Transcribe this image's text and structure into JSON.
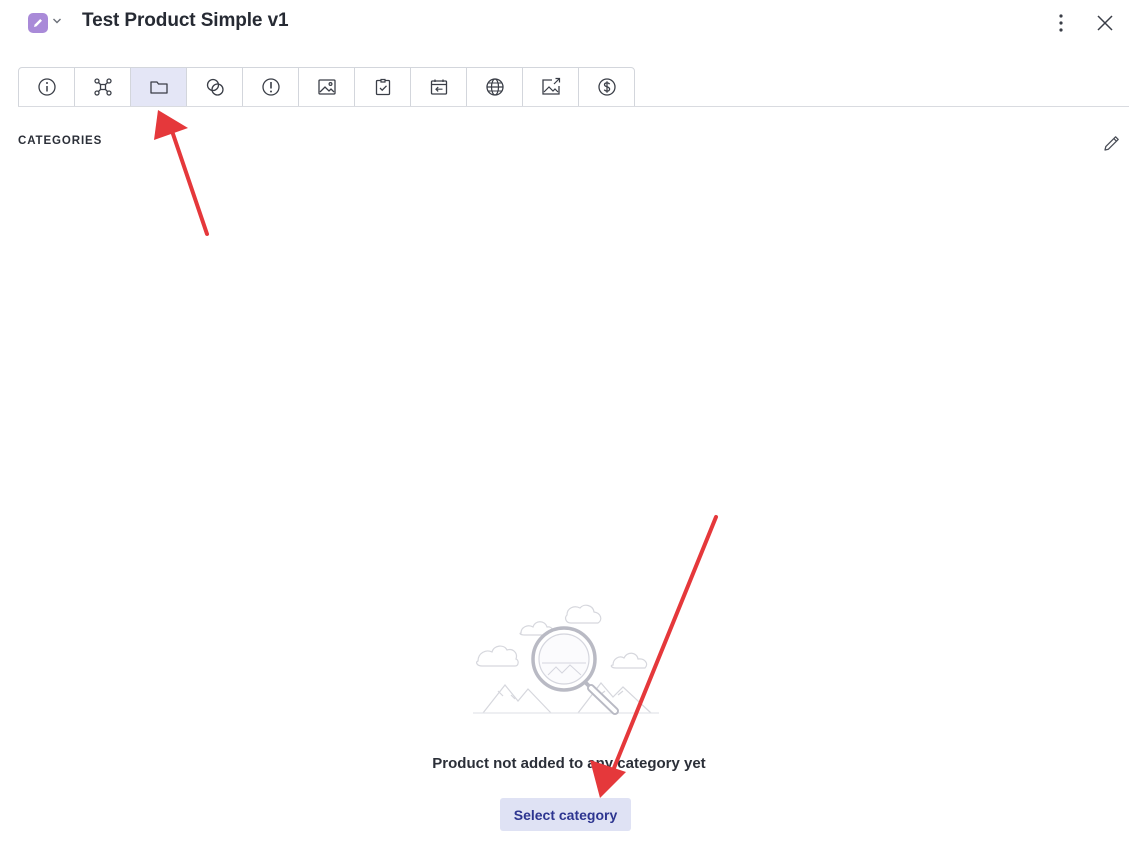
{
  "header": {
    "title": "Test Product Simple v1",
    "app_icon": "pencil-icon",
    "app_icon_color": "#a98ad8"
  },
  "toolbar": {
    "active_index": 2,
    "active_color": "#e4e6f6",
    "tabs": [
      {
        "icon": "info-icon"
      },
      {
        "icon": "network-icon"
      },
      {
        "icon": "folder-icon"
      },
      {
        "icon": "overlap-circles-icon"
      },
      {
        "icon": "alert-icon"
      },
      {
        "icon": "image-icon"
      },
      {
        "icon": "clipboard-check-icon"
      },
      {
        "icon": "calendar-back-icon"
      },
      {
        "icon": "globe-icon"
      },
      {
        "icon": "image-export-icon"
      },
      {
        "icon": "dollar-icon"
      }
    ]
  },
  "section": {
    "label": "CATEGORIES"
  },
  "empty_state": {
    "message": "Product not added to any category yet",
    "button_label": "Select category"
  },
  "annotation_color": "#e5383b"
}
